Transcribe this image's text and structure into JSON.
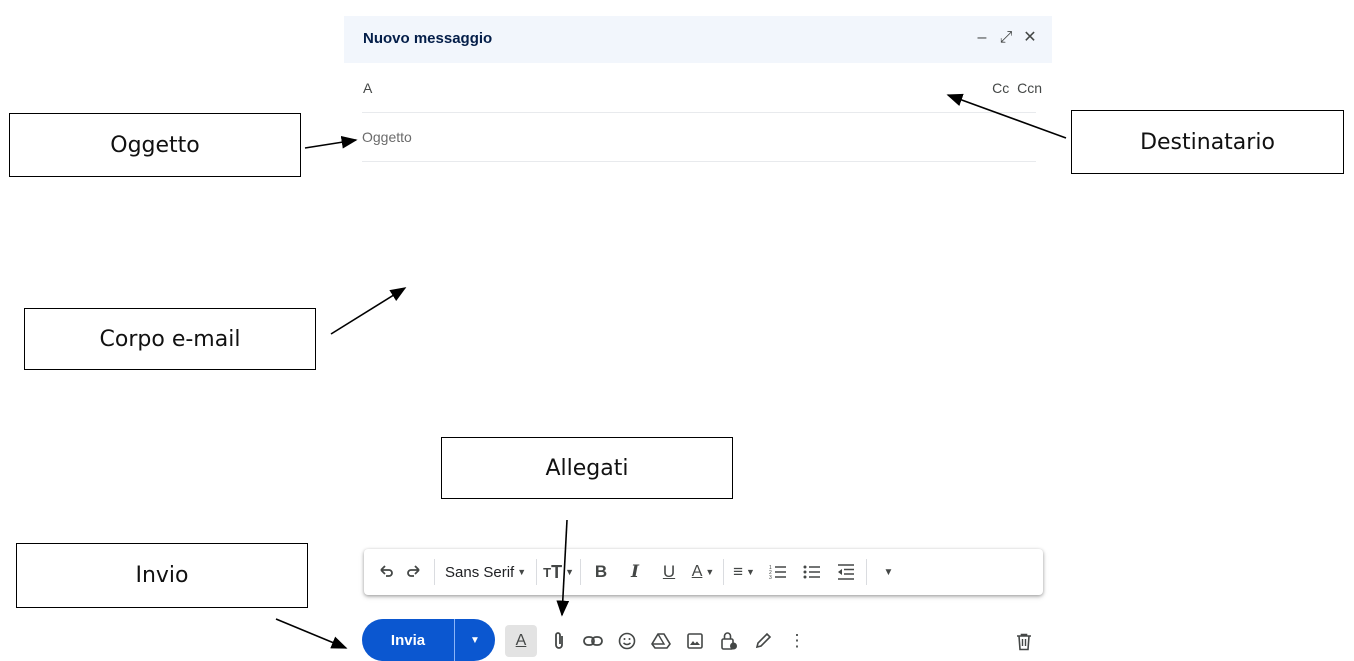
{
  "compose": {
    "title": "Nuovo messaggio",
    "controls": {
      "minimize": "–",
      "expand": "⤢",
      "close": "✕"
    },
    "to_label": "A",
    "cc_label": "Cc",
    "bcc_label": "Ccn",
    "subject_placeholder": "Oggetto"
  },
  "toolbar": {
    "undo_icon": "undo-icon",
    "redo_icon": "redo-icon",
    "font_family": "Sans Serif",
    "items": [
      "font-size-icon",
      "bold-icon",
      "italic-icon",
      "underline-icon",
      "text-color-icon",
      "align-icon",
      "numbered-list-icon",
      "bulleted-list-icon",
      "indent-less-icon",
      "more-formatting-icon"
    ]
  },
  "actions": {
    "send_label": "Invia",
    "icons": [
      "formatting-options-icon",
      "attach-icon",
      "link-icon",
      "emoji-icon",
      "drive-icon",
      "photo-icon",
      "confidential-icon",
      "signature-icon",
      "more-options-icon",
      "trash-icon"
    ],
    "accent_color": "#0b57d0"
  },
  "annotations": {
    "oggetto": "Oggetto",
    "destinatario": "Destinatario",
    "corpo": "Corpo e-mail",
    "allegati": "Allegati",
    "invio": "Invio"
  }
}
